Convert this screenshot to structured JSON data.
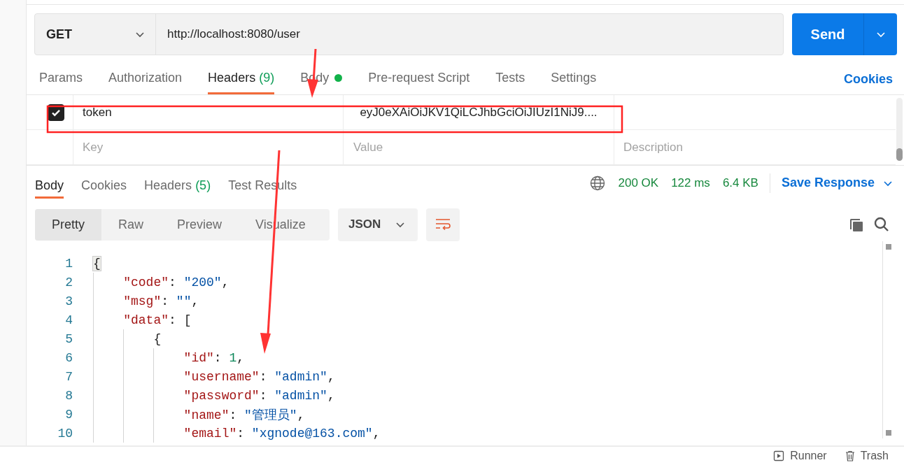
{
  "request": {
    "method": "GET",
    "url": "http://localhost:8080/user",
    "send": "Send"
  },
  "request_tabs": [
    {
      "label": "Params",
      "selected": false
    },
    {
      "label": "Authorization",
      "selected": false
    },
    {
      "label": "Headers",
      "count": "(9)",
      "selected": true
    },
    {
      "label": "Body",
      "dot": true,
      "selected": false
    },
    {
      "label": "Pre-request Script",
      "selected": false
    },
    {
      "label": "Tests",
      "selected": false
    },
    {
      "label": "Settings",
      "selected": false
    }
  ],
  "cookies_link": "Cookies",
  "headers": {
    "rows": [
      {
        "checked": true,
        "key": "token",
        "value": "eyJ0eXAiOiJKV1QiLCJhbGciOiJIUzI1NiJ9...."
      }
    ],
    "placeholder": {
      "key": "Key",
      "value": "Value",
      "description": "Description"
    }
  },
  "response_tabs": [
    {
      "label": "Body",
      "selected": true
    },
    {
      "label": "Cookies",
      "selected": false
    },
    {
      "label": "Headers",
      "count": "(5)",
      "selected": false
    },
    {
      "label": "Test Results",
      "selected": false
    }
  ],
  "status": {
    "code": "200 OK",
    "time": "122 ms",
    "size": "6.4 KB"
  },
  "save_response": "Save Response",
  "view_modes": [
    {
      "label": "Pretty",
      "selected": true
    },
    {
      "label": "Raw",
      "selected": false
    },
    {
      "label": "Preview",
      "selected": false
    },
    {
      "label": "Visualize",
      "selected": false
    }
  ],
  "format": "JSON",
  "code": [
    {
      "number": "1",
      "tokens": [
        {
          "kind": "punct",
          "text": "{"
        }
      ]
    },
    {
      "number": "2",
      "tokens": [
        {
          "kind": "key",
          "text": "    \"code\""
        },
        {
          "kind": "punct",
          "text": ": "
        },
        {
          "kind": "string",
          "text": "\"200\""
        },
        {
          "kind": "punct",
          "text": ","
        }
      ]
    },
    {
      "number": "3",
      "tokens": [
        {
          "kind": "key",
          "text": "    \"msg\""
        },
        {
          "kind": "punct",
          "text": ": "
        },
        {
          "kind": "string",
          "text": "\"\""
        },
        {
          "kind": "punct",
          "text": ","
        }
      ]
    },
    {
      "number": "4",
      "tokens": [
        {
          "kind": "key",
          "text": "    \"data\""
        },
        {
          "kind": "punct",
          "text": ": ["
        }
      ]
    },
    {
      "number": "5",
      "tokens": [
        {
          "kind": "punct",
          "text": "        {"
        }
      ]
    },
    {
      "number": "6",
      "tokens": [
        {
          "kind": "key",
          "text": "            \"id\""
        },
        {
          "kind": "punct",
          "text": ": "
        },
        {
          "kind": "number",
          "text": "1"
        },
        {
          "kind": "punct",
          "text": ","
        }
      ]
    },
    {
      "number": "7",
      "tokens": [
        {
          "kind": "key",
          "text": "            \"username\""
        },
        {
          "kind": "punct",
          "text": ": "
        },
        {
          "kind": "string",
          "text": "\"admin\""
        },
        {
          "kind": "punct",
          "text": ","
        }
      ]
    },
    {
      "number": "8",
      "tokens": [
        {
          "kind": "key",
          "text": "            \"password\""
        },
        {
          "kind": "punct",
          "text": ": "
        },
        {
          "kind": "string",
          "text": "\"admin\""
        },
        {
          "kind": "punct",
          "text": ","
        }
      ]
    },
    {
      "number": "9",
      "tokens": [
        {
          "kind": "key",
          "text": "            \"name\""
        },
        {
          "kind": "punct",
          "text": ": "
        },
        {
          "kind": "string",
          "text": "\"管理员\""
        },
        {
          "kind": "punct",
          "text": ","
        }
      ]
    },
    {
      "number": "10",
      "tokens": [
        {
          "kind": "key",
          "text": "            \"email\""
        },
        {
          "kind": "punct",
          "text": ": "
        },
        {
          "kind": "string",
          "text": "\"xgnode@163.com\""
        },
        {
          "kind": "punct",
          "text": ","
        }
      ]
    }
  ],
  "bottom_bar": {
    "runner": "Runner",
    "trash": "Trash"
  }
}
